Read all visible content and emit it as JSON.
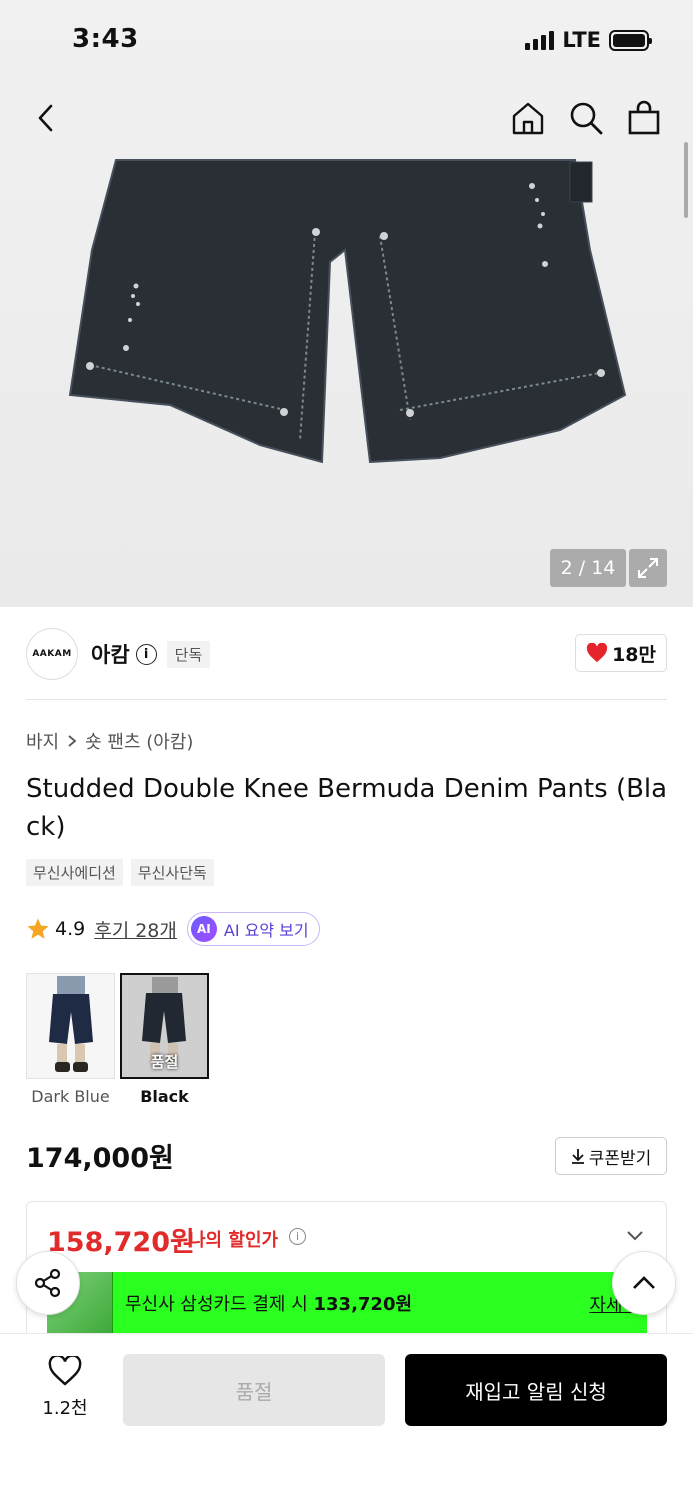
{
  "status_bar": {
    "time": "3:43",
    "network": "LTE"
  },
  "nav": {
    "back_icon": "chevron-left-icon",
    "home_icon": "home-icon",
    "search_icon": "search-icon",
    "cart_icon": "shopping-bag-icon"
  },
  "gallery": {
    "counter": "2 / 14",
    "expand_icon": "expand-icon"
  },
  "brand": {
    "logo_text": "AAKAM",
    "name": "아캄",
    "exclusive_tag": "단독",
    "likes": "18만"
  },
  "breadcrumb": {
    "category": "바지",
    "subcategory": "숏 팬츠 (아캄)"
  },
  "product": {
    "title": "Studded Double Knee Bermuda Denim Pants (Black)",
    "tags": [
      "무신사에디션",
      "무신사단독"
    ],
    "rating": "4.9",
    "reviews": "후기 28개",
    "ai_summary": "AI 요약 보기",
    "ai_badge": "AI"
  },
  "options": [
    {
      "label": "Dark Blue",
      "selected": false,
      "sold_out": false
    },
    {
      "label": "Black",
      "selected": true,
      "sold_out": true,
      "sold_out_text": "품절"
    }
  ],
  "pricing": {
    "price": "174,000원",
    "coupon": "쿠폰받기",
    "my_price": "158,720원",
    "my_price_label": "나의 할인가",
    "promo_text": "무신사 삼성카드 결제 시",
    "promo_price": "133,720원",
    "promo_more": "자세히"
  },
  "bottom_bar": {
    "wish_count": "1.2천",
    "sold_out_button": "품절",
    "restock_button": "재입고 알림 신청"
  },
  "colors": {
    "accent_red": "#e12b2b",
    "promo_green": "#2bff1f",
    "heart_red": "#e5252b"
  }
}
